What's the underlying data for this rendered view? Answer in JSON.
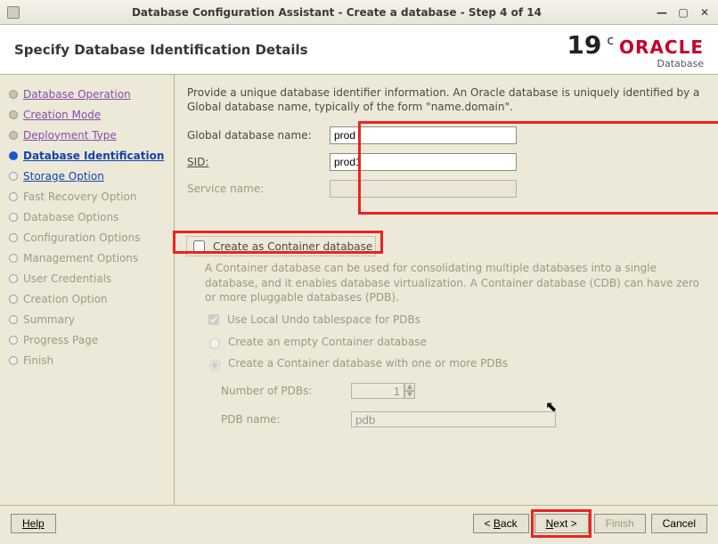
{
  "window": {
    "title": "Database Configuration Assistant - Create a database - Step 4 of 14"
  },
  "header": {
    "title": "Specify Database Identification Details",
    "version_num": "19",
    "version_sup": "c",
    "brand": "ORACLE",
    "brand_sub": "Database"
  },
  "sidebar": {
    "items": [
      {
        "label": "Database Operation",
        "state": "done"
      },
      {
        "label": "Creation Mode",
        "state": "done"
      },
      {
        "label": "Deployment Type",
        "state": "done"
      },
      {
        "label": "Database Identification",
        "state": "current"
      },
      {
        "label": "Storage Option",
        "state": "next"
      },
      {
        "label": "Fast Recovery Option",
        "state": "disabled"
      },
      {
        "label": "Database Options",
        "state": "disabled"
      },
      {
        "label": "Configuration Options",
        "state": "disabled"
      },
      {
        "label": "Management Options",
        "state": "disabled"
      },
      {
        "label": "User Credentials",
        "state": "disabled"
      },
      {
        "label": "Creation Option",
        "state": "disabled"
      },
      {
        "label": "Summary",
        "state": "disabled"
      },
      {
        "label": "Progress Page",
        "state": "disabled"
      },
      {
        "label": "Finish",
        "state": "disabled"
      }
    ]
  },
  "main": {
    "intro": "Provide a unique database identifier information. An Oracle database is uniquely identified by a Global database name, typically of the form \"name.domain\".",
    "gdn_label": "Global database name:",
    "gdn_value": "prod",
    "sid_label": "SID:",
    "sid_value": "prod1",
    "svc_label": "Service name:",
    "svc_value": "",
    "cdb_checkbox": "Create as Container database",
    "cdb_desc": "A Container database can be used for consolidating multiple databases into a single database, and it enables database virtualization. A Container database (CDB) can have zero or more pluggable databases (PDB).",
    "cdb_undo": "Use Local Undo tablespace for PDBs",
    "cdb_empty": "Create an empty Container database",
    "cdb_withpdb": "Create a Container database with one or more PDBs",
    "numpdb_label": "Number of PDBs:",
    "numpdb_value": "1",
    "pdbname_label": "PDB name:",
    "pdbname_value": "pdb"
  },
  "footer": {
    "help": "Help",
    "back": "< Back",
    "next": "Next >",
    "finish": "Finish",
    "cancel": "Cancel"
  }
}
